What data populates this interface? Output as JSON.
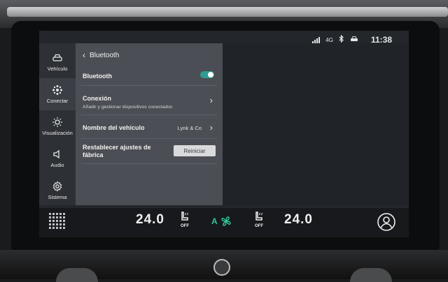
{
  "status_bar": {
    "time": "11:38",
    "icons": [
      "signal-icon",
      "network-4g-icon",
      "bluetooth-icon",
      "car-connect-icon"
    ],
    "network_label": "4G"
  },
  "rail": {
    "items": [
      {
        "label": "Vehículo",
        "icon": "car-icon",
        "active": false
      },
      {
        "label": "Conectar",
        "icon": "connect-icon",
        "active": true
      },
      {
        "label": "Visualización",
        "icon": "brightness-icon",
        "active": false
      },
      {
        "label": "Audio",
        "icon": "speaker-icon",
        "active": false
      },
      {
        "label": "Sistema",
        "icon": "gear-icon",
        "active": false
      }
    ]
  },
  "panel": {
    "title": "Bluetooth",
    "bluetooth_label": "Bluetooth",
    "bluetooth_enabled": true,
    "conexion_label": "Conexión",
    "conexion_sub": "Añadir y gestionar dispositivos conectados",
    "vehicle_name_label": "Nombre del vehículo",
    "vehicle_name_value": "Lynk & Co",
    "reset_label_1": "Restablecer ajustes de",
    "reset_label_2": "fábrica",
    "reset_button": "Reiniciar"
  },
  "climate": {
    "left_temp": "24.0",
    "left_seat": "OFF",
    "auto_fan": "A",
    "right_seat": "OFF",
    "right_temp": "24.0"
  },
  "colors": {
    "accent": "#2f9d93",
    "fan": "#2fc59a"
  }
}
